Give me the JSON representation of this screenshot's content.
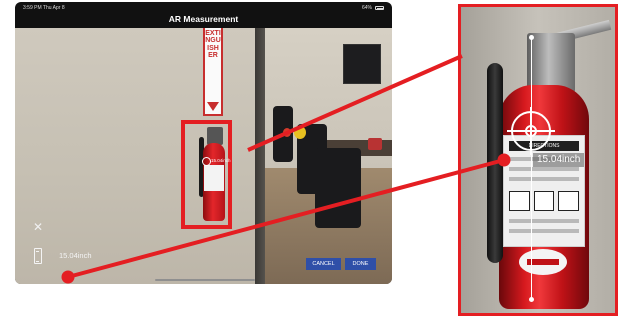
{
  "status_bar": {
    "time": "3:59 PM  Thu Apr 8",
    "right": "64%"
  },
  "nav": {
    "title": "AR Measurement"
  },
  "scene": {
    "sign_text": "EXTINGUISHER",
    "mini_measurement": "15.04inch"
  },
  "controls": {
    "close_symbol": "✕",
    "measurement": "15.04inch",
    "cancel_label": "CANCEL",
    "done_label": "DONE"
  },
  "zoom": {
    "measurement": "15.04inch",
    "label_title": "DIRECTIONS"
  },
  "colors": {
    "highlight": "#e41e22",
    "button": "#2f4fa8"
  }
}
